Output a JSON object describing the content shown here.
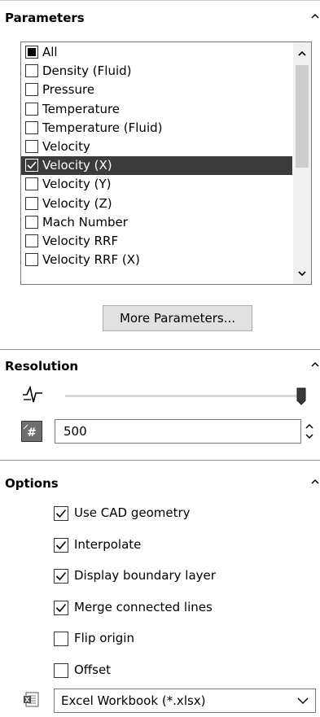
{
  "parameters": {
    "title": "Parameters",
    "items": [
      {
        "label": "All",
        "state": "partial",
        "selected": false
      },
      {
        "label": "Density (Fluid)",
        "state": "unchecked",
        "selected": false
      },
      {
        "label": "Pressure",
        "state": "unchecked",
        "selected": false
      },
      {
        "label": "Temperature",
        "state": "unchecked",
        "selected": false
      },
      {
        "label": "Temperature (Fluid)",
        "state": "unchecked",
        "selected": false
      },
      {
        "label": "Velocity",
        "state": "unchecked",
        "selected": false
      },
      {
        "label": "Velocity (X)",
        "state": "checked",
        "selected": true
      },
      {
        "label": "Velocity (Y)",
        "state": "unchecked",
        "selected": false
      },
      {
        "label": "Velocity (Z)",
        "state": "unchecked",
        "selected": false
      },
      {
        "label": "Mach Number",
        "state": "unchecked",
        "selected": false
      },
      {
        "label": "Velocity RRF",
        "state": "unchecked",
        "selected": false
      },
      {
        "label": "Velocity RRF (X)",
        "state": "unchecked",
        "selected": false
      }
    ],
    "more_button": "More Parameters..."
  },
  "resolution": {
    "title": "Resolution",
    "slider_level_percent": 100,
    "value": "500",
    "icons": {
      "resolution": "resolution-icon",
      "number": "number-entry-icon"
    }
  },
  "options": {
    "title": "Options",
    "items": [
      {
        "label": "Use CAD geometry",
        "checked": true
      },
      {
        "label": "Interpolate",
        "checked": true
      },
      {
        "label": "Display boundary layer",
        "checked": true
      },
      {
        "label": "Merge connected lines",
        "checked": true
      },
      {
        "label": "Flip origin",
        "checked": false
      },
      {
        "label": "Offset",
        "checked": false
      }
    ],
    "export_format": "Excel Workbook (*.xlsx)"
  }
}
